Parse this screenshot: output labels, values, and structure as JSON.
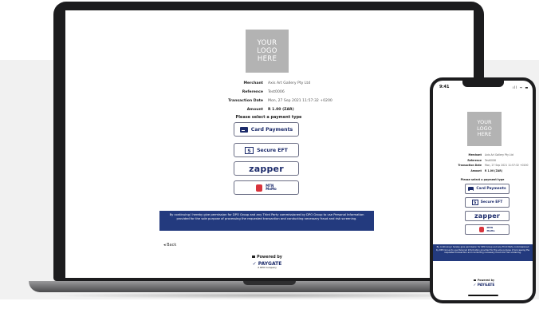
{
  "logo": {
    "line1": "YOUR",
    "line2": "LOGO",
    "line3": "HERE"
  },
  "details": {
    "merchant_label": "Merchant",
    "merchant_value": "Axis Art Gallery Pty Ltd",
    "reference_label": "Reference",
    "reference_value": "Test0006",
    "date_label": "Transaction Date",
    "date_value": "Mon, 27 Sep 2021 11:57:32 +0200",
    "amount_label": "Amount",
    "amount_value": "R 1.00 (ZAR)"
  },
  "select_title": "Please select a payment type",
  "payment_options": {
    "card": "Card Payments",
    "eft": "Secure EFT",
    "zapper": "zapper",
    "momo_top": "MTN",
    "momo": "MoMo"
  },
  "consent_text": "By continuing I hereby give permission for DPO Group and any Third Party commissioned by DPO Group to use Personal Information provided for the sole purpose of processing the requested transaction and conducting necessary fraud and risk screening.",
  "back_label": "Back",
  "powered_by": "Powered by",
  "brand": "PAYGATE",
  "brand_sub": "A DPO Company",
  "phone": {
    "time": "9:41",
    "status": "ıll ᯤ ▬"
  }
}
